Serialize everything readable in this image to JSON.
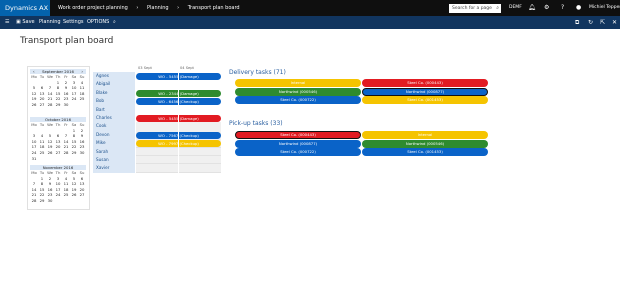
{
  "app": {
    "title": "Dynamics AX"
  },
  "breadcrumbs": [
    "Work order project planning",
    "Planning",
    "Transport plan board"
  ],
  "search": {
    "placeholder": "Search for a page"
  },
  "company": "DEMF",
  "user": "Michiel Teppers",
  "toolbar": {
    "save": "Save",
    "planning": "Planning",
    "settings": "Settings",
    "options": "OPTIONS"
  },
  "page": {
    "title": "Transport plan board"
  },
  "calendars": [
    {
      "month": "September 2016",
      "days": [
        "Mo",
        "Tu",
        "We",
        "Th",
        "Fr",
        "Sa",
        "Su"
      ],
      "cells": [
        "",
        "",
        "",
        "1",
        "2",
        "3",
        "4",
        "5",
        "6",
        "7",
        "8",
        "9",
        "10",
        "11",
        "12",
        "13",
        "14",
        "15",
        "16",
        "17",
        "18",
        "19",
        "20",
        "21",
        "22",
        "23",
        "24",
        "25",
        "26",
        "27",
        "28",
        "29",
        "30",
        "",
        ""
      ]
    },
    {
      "month": "October 2016",
      "days": [
        "Mo",
        "Tu",
        "We",
        "Th",
        "Fr",
        "Sa",
        "Su"
      ],
      "cells": [
        "",
        "",
        "",
        "",
        "",
        "1",
        "2",
        "3",
        "4",
        "5",
        "6",
        "7",
        "8",
        "9",
        "10",
        "11",
        "12",
        "13",
        "14",
        "15",
        "16",
        "17",
        "18",
        "19",
        "20",
        "21",
        "22",
        "23",
        "24",
        "25",
        "26",
        "27",
        "28",
        "29",
        "30",
        "31",
        "",
        "",
        "",
        "",
        "",
        ""
      ]
    },
    {
      "month": "November 2016",
      "days": [
        "Mo",
        "Tu",
        "We",
        "Th",
        "Fr",
        "Sa",
        "Su"
      ],
      "cells": [
        "",
        "1",
        "2",
        "3",
        "4",
        "5",
        "6",
        "7",
        "8",
        "9",
        "10",
        "11",
        "12",
        "13",
        "14",
        "15",
        "16",
        "17",
        "18",
        "19",
        "20",
        "21",
        "22",
        "23",
        "24",
        "25",
        "26",
        "27",
        "28",
        "29",
        "30",
        "",
        "",
        "",
        ""
      ]
    }
  ],
  "schedule": {
    "dates": [
      "03 Sept",
      "04 Sept"
    ],
    "resources": [
      "Agnes",
      "Abigail",
      "Blake",
      "Bob",
      "Bart",
      "Charles",
      "Cook",
      "Devon",
      "Mike",
      "Sarah",
      "Susan",
      "Xavier"
    ],
    "tasks": [
      {
        "label": "WO - 5455 (Damage)",
        "row": 0,
        "color": "blue"
      },
      {
        "label": "WO - 2344 (Damage)",
        "row": 2,
        "color": "green"
      },
      {
        "label": "WO - 6456 (Checkup)",
        "row": 3,
        "color": "blue"
      },
      {
        "label": "WO - 5455 (Damage)",
        "row": 5,
        "color": "red"
      },
      {
        "label": "WO - 7567 (Checkup)",
        "row": 7,
        "color": "blue"
      },
      {
        "label": "WO - 7997 (Checkup)",
        "row": 8,
        "color": "yellow"
      }
    ]
  },
  "delivery": {
    "title": "Delivery tasks",
    "count": "(71)",
    "left": [
      {
        "label": "Internal",
        "color": "yellow"
      },
      {
        "label": "Northwind (000546)",
        "color": "green"
      },
      {
        "label": "Steel Co. (000722)",
        "color": "blue"
      }
    ],
    "right": [
      {
        "label": "Steel Co. (000443)",
        "color": "red"
      },
      {
        "label": "Northwind (000877)",
        "color": "blue",
        "outlined": true
      },
      {
        "label": "Steel Co. (001453)",
        "color": "yellow"
      }
    ]
  },
  "pickup": {
    "title": "Pick-up tasks",
    "count": "(33)",
    "left": [
      {
        "label": "Steel Co. (000443)",
        "color": "red",
        "outlined": true
      },
      {
        "label": "Northwind (000877)",
        "color": "blue"
      },
      {
        "label": "Steel Co. (000722)",
        "color": "blue"
      }
    ],
    "right": [
      {
        "label": "Internal",
        "color": "yellow"
      },
      {
        "label": "Northwind (000546)",
        "color": "green"
      },
      {
        "label": "Steel Co. (001453)",
        "color": "blue"
      }
    ]
  },
  "icons": [
    "grid-menu-icon",
    "search-icon",
    "bell-icon",
    "gear-icon",
    "help-icon",
    "avatar-icon",
    "save-icon",
    "office-icon",
    "refresh-icon",
    "open-new-icon",
    "close-icon"
  ]
}
